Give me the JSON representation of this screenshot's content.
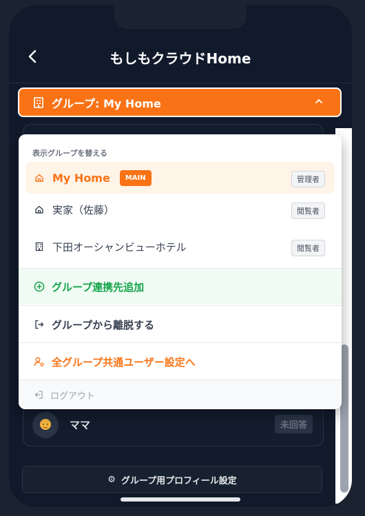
{
  "header": {
    "title": "もしもクラウドHome"
  },
  "group_select": {
    "label": "グループ: My Home"
  },
  "dropdown": {
    "heading": "表示グループを替える",
    "groups": [
      {
        "name": "My Home",
        "badge": "MAIN",
        "role": "管理者",
        "icon": "home-icon",
        "active": true
      },
      {
        "name": "実家（佐藤）",
        "role": "閲覧者",
        "icon": "home-icon"
      },
      {
        "name": "下田オーシャンビューホテル",
        "role": "閲覧者",
        "icon": "building-icon"
      }
    ],
    "actions": {
      "add": "グループ連携先追加",
      "leave": "グループから離脱する",
      "global": "全グループ共通ユーザー設定へ",
      "logout": "ログアウト"
    }
  },
  "background": {
    "member_name": "ママ",
    "member_status": "未回答",
    "profile_button": "グループ用プロフィール設定"
  },
  "colors": {
    "accent": "#f97316",
    "green": "#16a34a",
    "bg": "#111a2b"
  }
}
